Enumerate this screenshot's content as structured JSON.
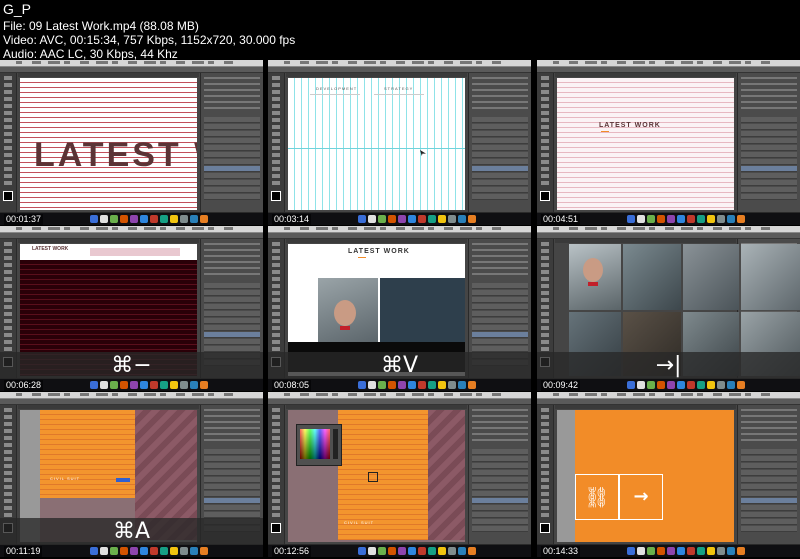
{
  "sheet": {
    "title": "G_P",
    "file_line": "File: 09  Latest Work.mp4 (88.08 MB)",
    "video_line": "Video: AVC, 00:15:34, 757 Kbps, 1152x720, 30.000 fps",
    "audio_line": "Audio: AAC LC, 30 Kbps, 44 Khz"
  },
  "thumbnails": [
    {
      "timestamp": "00:01:37",
      "headline": "LATEST W"
    },
    {
      "timestamp": "00:03:14",
      "col_headings": [
        "DEVELOPMENT",
        "STRATEGY"
      ]
    },
    {
      "timestamp": "00:04:51",
      "headline": "LATEST WORK"
    },
    {
      "timestamp": "00:06:28",
      "headline": "LATEST WORK",
      "shortcut": "⌘−"
    },
    {
      "timestamp": "00:08:05",
      "headline": "LATEST WORK",
      "shortcut": "⌘V"
    },
    {
      "timestamp": "00:09:42",
      "shortcut": "→|"
    },
    {
      "timestamp": "00:11:19",
      "caption": "CIVIL SUIT",
      "shortcut": "⌘A"
    },
    {
      "timestamp": "00:12:56",
      "caption": "CIVIL SUIT"
    },
    {
      "timestamp": "00:14:33",
      "link_icon": "⛓",
      "arrow_icon": "→"
    }
  ],
  "colors": {
    "ps_dark": "#454545",
    "stripe_red": "#c24f5b",
    "orange": "#f28c28",
    "headline": "#5b3436"
  }
}
